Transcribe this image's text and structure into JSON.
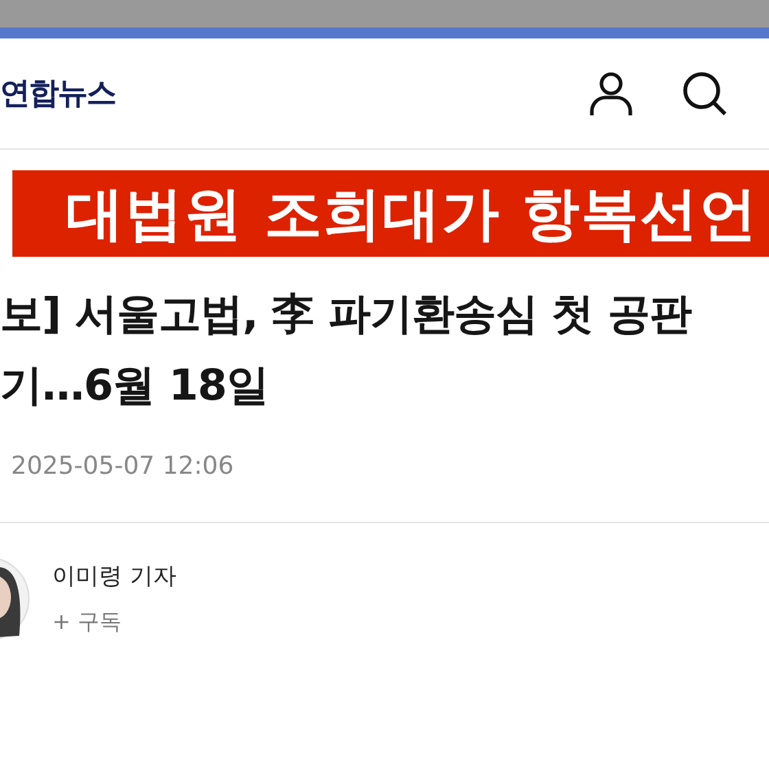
{
  "header": {
    "logo": "연합뉴스"
  },
  "banner": {
    "text": "대법원 조희대가 항복선언"
  },
  "article": {
    "headline_lines": [
      "보] 서울고법, 李 파기환송심 첫 공판",
      "기…6월 18일"
    ],
    "date": "2025-05-07 12:06"
  },
  "author": {
    "name": "이미령 기자",
    "subscribe": "+ 구독"
  }
}
